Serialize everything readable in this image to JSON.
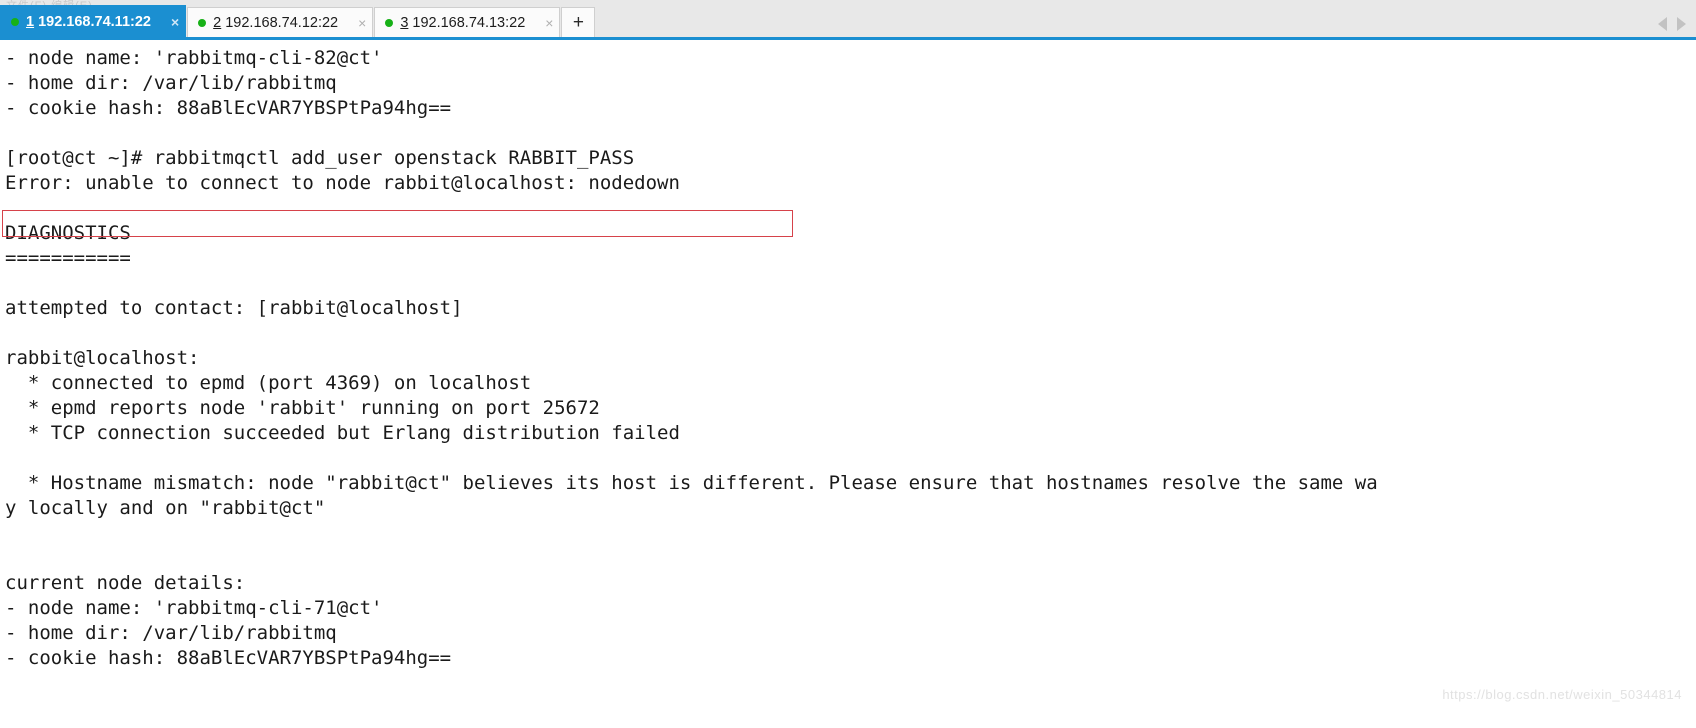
{
  "window": {
    "ghost_title": "文件(F)  编辑(E)"
  },
  "tabbar": {
    "tabs": [
      {
        "index": "1",
        "label": "192.168.74.11:22",
        "status": "connected",
        "active": true,
        "close_glyph": "×"
      },
      {
        "index": "2",
        "label": "192.168.74.12:22",
        "status": "connected",
        "active": false,
        "close_glyph": "×"
      },
      {
        "index": "3",
        "label": "192.168.74.13:22",
        "status": "connected",
        "active": false,
        "close_glyph": "×"
      }
    ],
    "new_tab_label": "+",
    "scroll_left_icon": "chevron-left-icon",
    "scroll_right_icon": "chevron-right-icon",
    "accent_color": "#1b8fd1",
    "status_dot_color": "#17b117"
  },
  "terminal": {
    "prompt": "[root@ct ~]#",
    "command": "rabbitmqctl add_user openstack RABBIT_PASS",
    "error_highlight_color": "#d6424a",
    "lines": [
      "- node name: 'rabbitmq-cli-82@ct'",
      "- home dir: /var/lib/rabbitmq",
      "- cookie hash: 88aBlEcVAR7YBSPtPa94hg==",
      "",
      "[root@ct ~]# rabbitmqctl add_user openstack RABBIT_PASS",
      "Error: unable to connect to node rabbit@localhost: nodedown",
      "",
      "DIAGNOSTICS",
      "===========",
      "",
      "attempted to contact: [rabbit@localhost]",
      "",
      "rabbit@localhost:",
      "  * connected to epmd (port 4369) on localhost",
      "  * epmd reports node 'rabbit' running on port 25672",
      "  * TCP connection succeeded but Erlang distribution failed",
      "",
      "  * Hostname mismatch: node \"rabbit@ct\" believes its host is different. Please ensure that hostnames resolve the same wa",
      "y locally and on \"rabbit@ct\"",
      "",
      "",
      "current node details:",
      "- node name: 'rabbitmq-cli-71@ct'",
      "- home dir: /var/lib/rabbitmq",
      "- cookie hash: 88aBlEcVAR7YBSPtPa94hg=="
    ]
  },
  "watermark": {
    "text": "https://blog.csdn.net/weixin_50344814"
  }
}
